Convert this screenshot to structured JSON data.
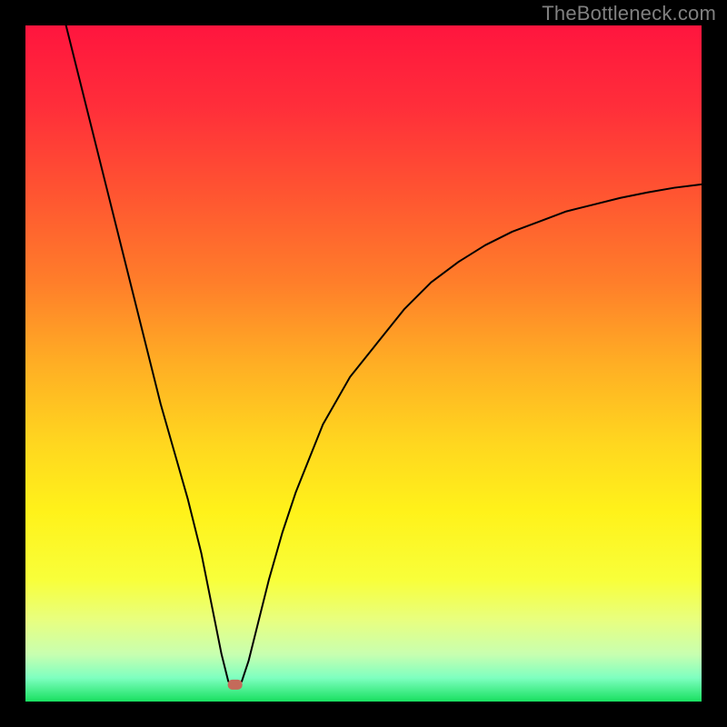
{
  "watermark": "TheBottleneck.com",
  "chart_data": {
    "type": "line",
    "title": "",
    "xlabel": "",
    "ylabel": "",
    "xlim": [
      0,
      100
    ],
    "ylim": [
      0,
      100
    ],
    "optimum_x": 31,
    "marker": {
      "x": 31,
      "y": 2.5,
      "color": "#c46a5a"
    },
    "series": [
      {
        "name": "bottleneck-curve",
        "x": [
          6,
          8,
          10,
          12,
          14,
          16,
          18,
          20,
          22,
          24,
          26,
          28,
          29,
          30,
          31,
          32,
          33,
          34,
          36,
          38,
          40,
          44,
          48,
          52,
          56,
          60,
          64,
          68,
          72,
          76,
          80,
          84,
          88,
          92,
          96,
          100
        ],
        "y": [
          100,
          92,
          84,
          76,
          68,
          60,
          52,
          44,
          37,
          30,
          22,
          12,
          7,
          3,
          2,
          3,
          6,
          10,
          18,
          25,
          31,
          41,
          48,
          53,
          58,
          62,
          65,
          67.5,
          69.5,
          71,
          72.5,
          73.5,
          74.5,
          75.3,
          76,
          76.5
        ]
      }
    ],
    "background_gradient": {
      "stops": [
        {
          "offset": 0.0,
          "color": "#ff153e"
        },
        {
          "offset": 0.12,
          "color": "#ff2e3a"
        },
        {
          "offset": 0.25,
          "color": "#ff5531"
        },
        {
          "offset": 0.38,
          "color": "#ff7e2a"
        },
        {
          "offset": 0.5,
          "color": "#ffae24"
        },
        {
          "offset": 0.62,
          "color": "#ffd71f"
        },
        {
          "offset": 0.72,
          "color": "#fff21a"
        },
        {
          "offset": 0.82,
          "color": "#f8ff3a"
        },
        {
          "offset": 0.88,
          "color": "#e8ff80"
        },
        {
          "offset": 0.93,
          "color": "#c8ffb0"
        },
        {
          "offset": 0.965,
          "color": "#7effc0"
        },
        {
          "offset": 1.0,
          "color": "#18e060"
        }
      ]
    },
    "frame": {
      "outer": 800,
      "inner_top": 28,
      "inner_left": 28,
      "inner_size": 744
    }
  }
}
